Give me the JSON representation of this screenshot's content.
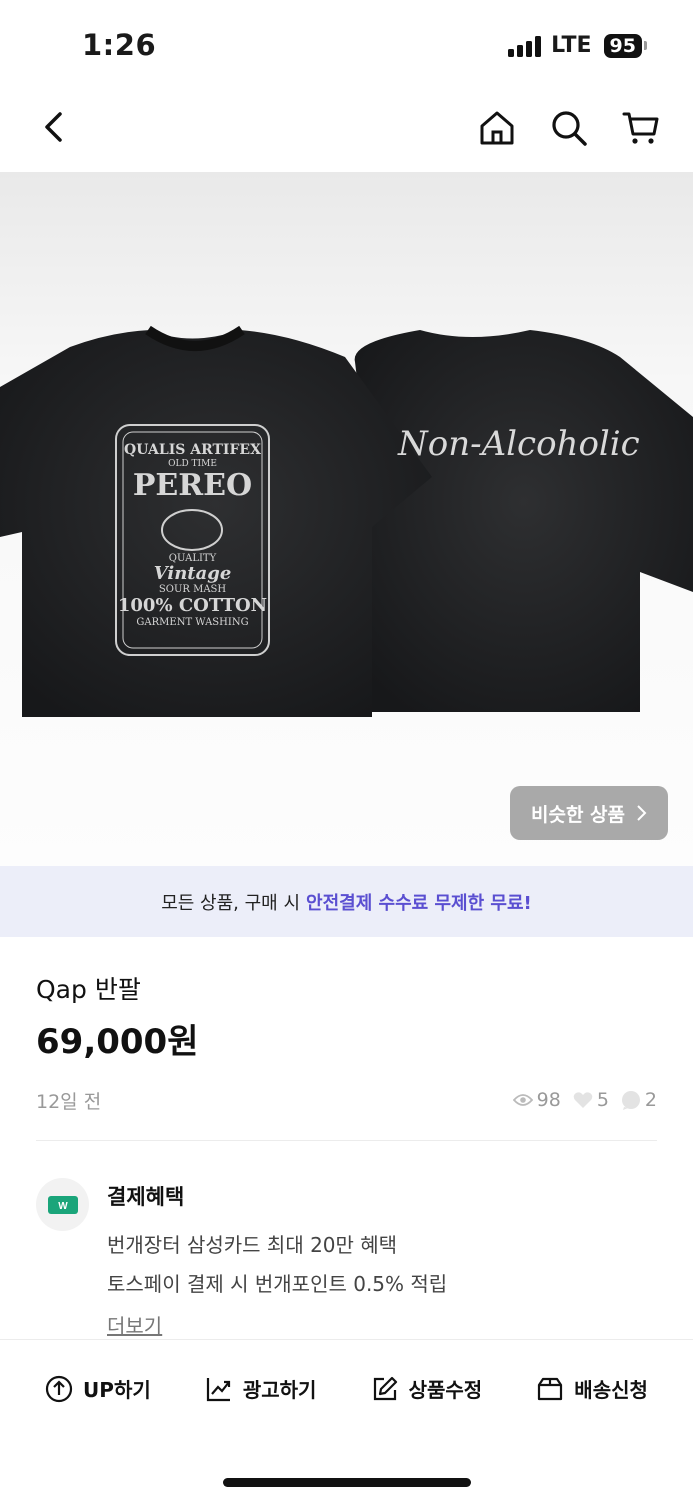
{
  "status_bar": {
    "time": "1:26",
    "network": "LTE",
    "battery": "95"
  },
  "nav": {
    "back_icon": "chevron-left-icon",
    "icons": [
      "home-icon",
      "search-icon",
      "cart-icon"
    ]
  },
  "product_image": {
    "front_print": {
      "line1": "QUALIS ARTIFEX",
      "line2": "OLD TIME",
      "line3": "PEREO",
      "line4": "QUALITY",
      "line5": "Vintage",
      "line6": "SOUR MASH",
      "line7": "100% COTTON",
      "line8": "GARMENT WASHING"
    },
    "back_print": "Non-Alcoholic",
    "similar_button": "비슷한 상품"
  },
  "promo": {
    "normal_text": "모든 상품, 구매 시",
    "highlight_text": "안전결제 수수료 무제한 무료!"
  },
  "product": {
    "title": "Qap 반팔",
    "price": "69,000원",
    "posted": "12일 전",
    "views": "98",
    "likes": "5",
    "chats": "2"
  },
  "benefit": {
    "title": "결제혜택",
    "line1": "번개장터 삼성카드 최대 20만 혜택",
    "line2": "토스페이 결제 시 번개포인트 0.5% 적립",
    "more": "더보기"
  },
  "actions": [
    {
      "label": "UP하기",
      "icon": "up-arrow-circle-icon"
    },
    {
      "label": "광고하기",
      "icon": "trending-chart-icon"
    },
    {
      "label": "상품수정",
      "icon": "edit-icon"
    },
    {
      "label": "배송신청",
      "icon": "box-icon"
    }
  ],
  "colors": {
    "promo_bg": "#eceef9",
    "promo_accent": "#5a4fd1",
    "benefit_icon": "#1aa57a"
  }
}
